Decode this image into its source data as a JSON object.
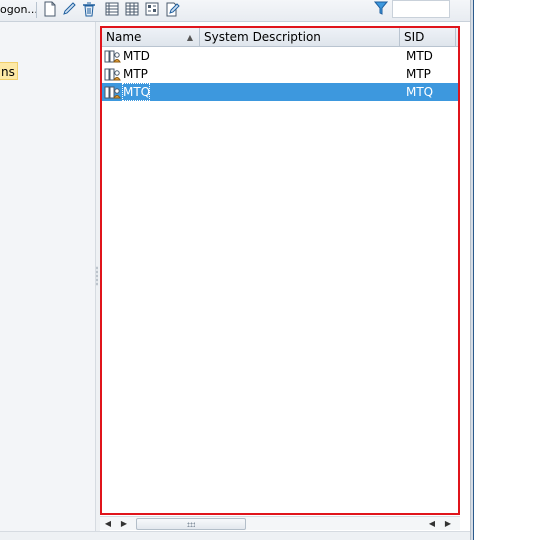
{
  "toolbar": {
    "truncated_button_label": "ogon...",
    "icons": [
      "new-document-icon",
      "edit-pencil-icon",
      "delete-trash-icon",
      "list-view-icon",
      "tree-view-icon",
      "properties-icon",
      "change-icon",
      "filter-funnel-icon"
    ]
  },
  "left_pane": {
    "tag_label": "ns"
  },
  "grid": {
    "columns": [
      {
        "label": "Name"
      },
      {
        "label": "System Description"
      },
      {
        "label": "SID"
      }
    ],
    "sort_indicator": "▲",
    "rows": [
      {
        "name": "MTD",
        "description": "",
        "sid": "MTD",
        "selected": false
      },
      {
        "name": "MTP",
        "description": "",
        "sid": "MTP",
        "selected": false
      },
      {
        "name": "MTQ",
        "description": "",
        "sid": "MTQ",
        "selected": true
      }
    ]
  },
  "scrollbar": {
    "left_arrow": "◀",
    "right_arrow": "▶"
  },
  "colors": {
    "selection": "#3d98de",
    "highlight_frame": "#e0141b",
    "tag_background": "#fde9a6"
  }
}
